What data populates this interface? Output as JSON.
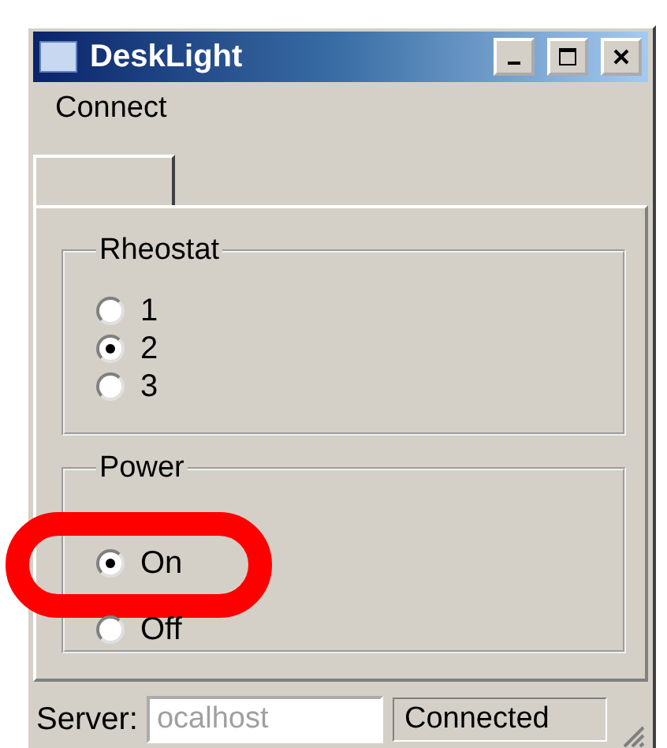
{
  "window": {
    "title": "DeskLight"
  },
  "menu": [
    {
      "label": "Connect"
    }
  ],
  "groups": [
    {
      "title": "Rheostat",
      "options": [
        {
          "label": "1",
          "selected": false,
          "highlighted": false
        },
        {
          "label": "2",
          "selected": true,
          "highlighted": false
        },
        {
          "label": "3",
          "selected": false,
          "highlighted": false
        }
      ]
    },
    {
      "title": "Power",
      "options": [
        {
          "label": "On",
          "selected": true,
          "highlighted": true
        },
        {
          "label": "Off",
          "selected": false,
          "highlighted": false
        }
      ]
    }
  ],
  "status_bar": {
    "server_label": "Server:",
    "server_field": {
      "value": "ocalhost",
      "disabled": true
    },
    "status": "Connected"
  }
}
